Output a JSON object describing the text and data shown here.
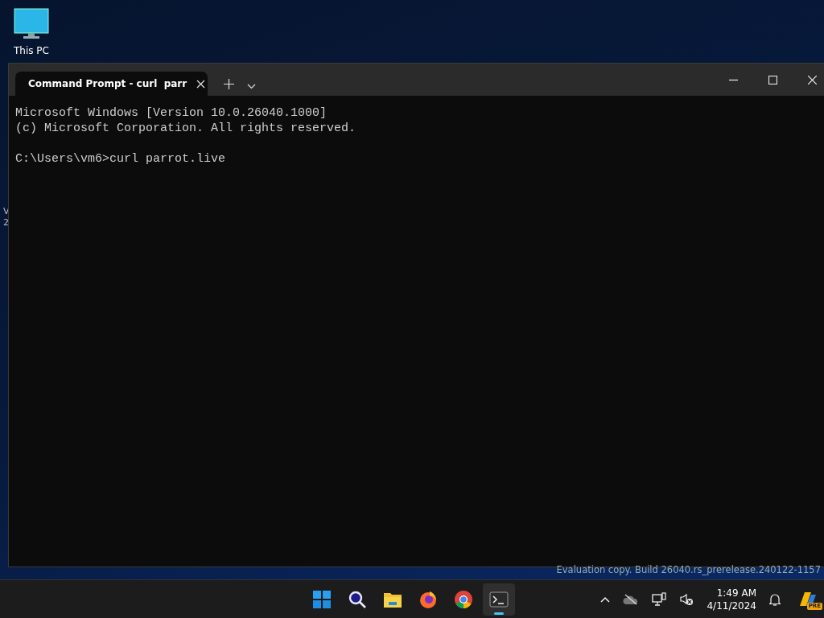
{
  "desktop_icons": [
    {
      "label": "This PC"
    }
  ],
  "desktop_fragments": [
    "V",
    "2"
  ],
  "window": {
    "tabs": [
      {
        "title": "Command Prompt - curl  parr",
        "selected": true
      }
    ],
    "console_blocks": [
      [
        "Microsoft Windows [Version 10.0.26040.1000]",
        "(c) Microsoft Corporation. All rights reserved."
      ],
      [
        "C:\\Users\\vm6>curl parrot.live"
      ]
    ]
  },
  "evaluation_notice": "Evaluation copy. Build 26040.rs_prerelease.240122-1157",
  "taskbar": {
    "apps": [
      {
        "kind": "start",
        "active": false
      },
      {
        "kind": "search",
        "active": false
      },
      {
        "kind": "files",
        "active": false
      },
      {
        "kind": "firefox",
        "active": false
      },
      {
        "kind": "chrome",
        "active": false
      },
      {
        "kind": "terminal",
        "active": true
      }
    ],
    "time": "1:49 AM",
    "date": "4/11/2024",
    "copilot_badge": "PRE"
  }
}
